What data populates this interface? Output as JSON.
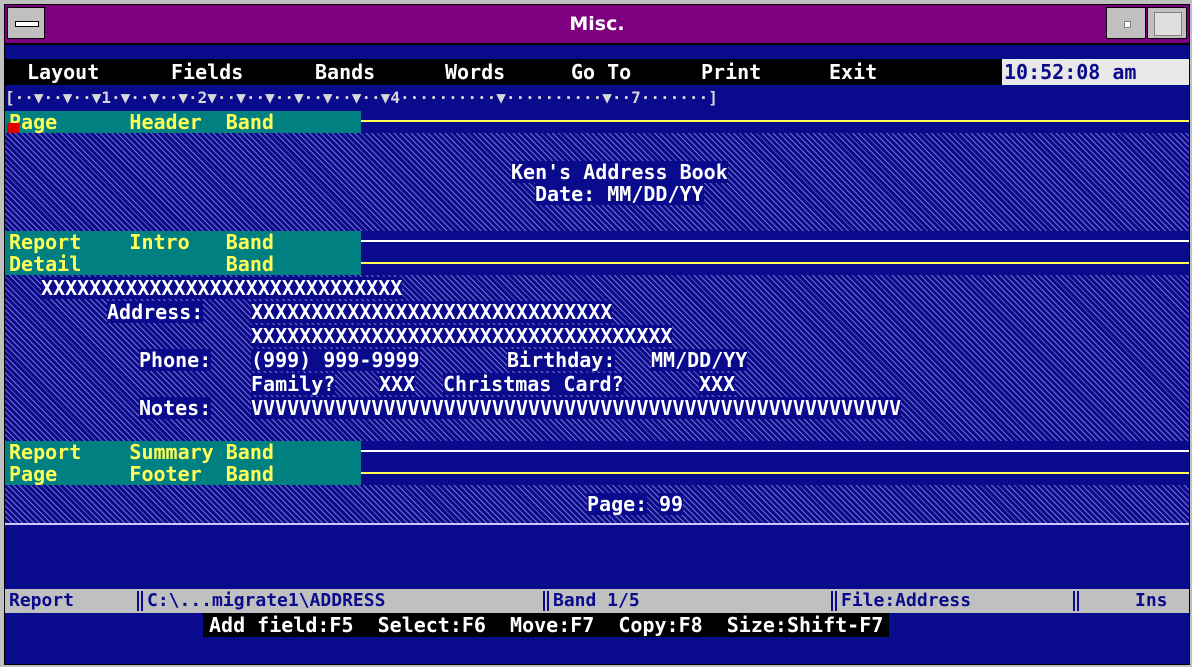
{
  "window": {
    "title": "Misc."
  },
  "menu": {
    "items": [
      "Layout",
      "Fields",
      "Bands",
      "Words",
      "Go To",
      "Print",
      "Exit"
    ],
    "clock": "10:52:08 am"
  },
  "ruler": {
    "text": "[··▼··▼··▼1·▼··▼··▼·2▼··▼··▼··▼··▼··▼··▼4··········▼··········▼··7·······]"
  },
  "bands": {
    "page_header": "Page      Header  Band",
    "report_intro": "Report    Intro   Band",
    "detail": "Detail            Band",
    "report_summary": "Report    Summary Band",
    "page_footer": "Page      Footer  Band"
  },
  "header_content": {
    "title": "Ken's Address Book",
    "date": "Date: MM/DD/YY"
  },
  "detail_content": {
    "name_field": "XXXXXXXXXXXXXXXXXXXXXXXXXXXXXX",
    "address_label": "Address:",
    "address1_field": "XXXXXXXXXXXXXXXXXXXXXXXXXXXXXX",
    "address2_field": "XXXXXXXXXXXXXXXXXXXXXXXXXXXXXXXXXXX",
    "phone_label": "Phone:",
    "phone_field": "(999) 999-9999",
    "birthday_label": "Birthday:",
    "birthday_field": "MM/DD/YY",
    "family_label": "Family?",
    "family_field": "XXX",
    "christmas_label": "Christmas Card?",
    "christmas_field": "XXX",
    "notes_label": "Notes:",
    "notes_field": "VVVVVVVVVVVVVVVVVVVVVVVVVVVVVVVVVVVVVVVVVVVVVVVVVVVVVV"
  },
  "footer_content": {
    "page_label": "Page:",
    "page_field": "99"
  },
  "status": {
    "mode": "Report",
    "path": "C:\\...migrate1\\ADDRESS",
    "band": "Band 1/5",
    "file": "File:Address",
    "ins": "Ins"
  },
  "keys": {
    "text": "Add field:F5  Select:F6  Move:F7  Copy:F8  Size:Shift-F7"
  },
  "colors": {
    "background": "#0a0a8c",
    "title_bar": "#7f007f",
    "band_label_bg": "#008080",
    "band_label_fg": "#ffff55"
  }
}
